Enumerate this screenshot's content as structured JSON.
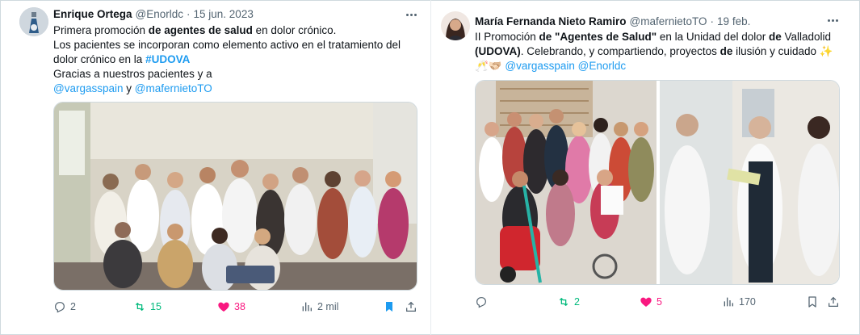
{
  "tweets": [
    {
      "author": {
        "name": "Enrique Ortega",
        "handle": "@Enorldc",
        "date": "15 jun. 2023"
      },
      "text": {
        "l1_a": "Primera promoción ",
        "l1_b": "de agentes de salud",
        "l1_c": " en dolor crónico.",
        "l2": "Los pacientes se incorporan como elemento activo en el tratamiento del",
        "l3_a": "dolor crónico en la ",
        "l3_tag": "#UDOVA",
        "l4": "Gracias a nuestros pacientes y a",
        "l5_m1": "@vargasspain",
        "l5_y": " y ",
        "l5_m2": "@mafernietoTO"
      },
      "media_alt": "group-photo",
      "stats": {
        "replies": "2",
        "retweets": "15",
        "likes": "38",
        "views": "2 mil"
      }
    },
    {
      "author": {
        "name": "María Fernanda Nieto Ramiro",
        "handle": "@mafernietoTO",
        "date": "19 feb."
      },
      "text": {
        "l1_a": "II Promoción ",
        "l1_b": "de \"Agentes de Salud\"",
        "l1_c": " en la Unidad del dolor ",
        "l1_d": "de",
        "l1_e": " Valladolid",
        "l2_a": "(UDOVA)",
        "l2_b": ". Celebrando, y compartiendo, proyectos ",
        "l2_c": "de",
        "l2_d": " ilusión y cuidado ",
        "l2_emoji": "✨",
        "l3_emoji": "🥂🫱🏻‍🫲🏼",
        "l3_m1": "@vargasspain",
        "l3_m2": "@Enorldc"
      },
      "media_alt": "two-photos",
      "stats": {
        "replies": "",
        "retweets": "2",
        "likes": "5",
        "views": "170"
      }
    }
  ],
  "colors": {
    "link": "#1d9bf0",
    "retweet": "#00ba7c",
    "like": "#f91880",
    "bookmark": "#1d9bf0",
    "muted": "#536471"
  },
  "icons": [
    "reply-icon",
    "retweet-icon",
    "heart-icon",
    "views-icon",
    "bookmark-icon",
    "share-icon",
    "more-icon"
  ]
}
